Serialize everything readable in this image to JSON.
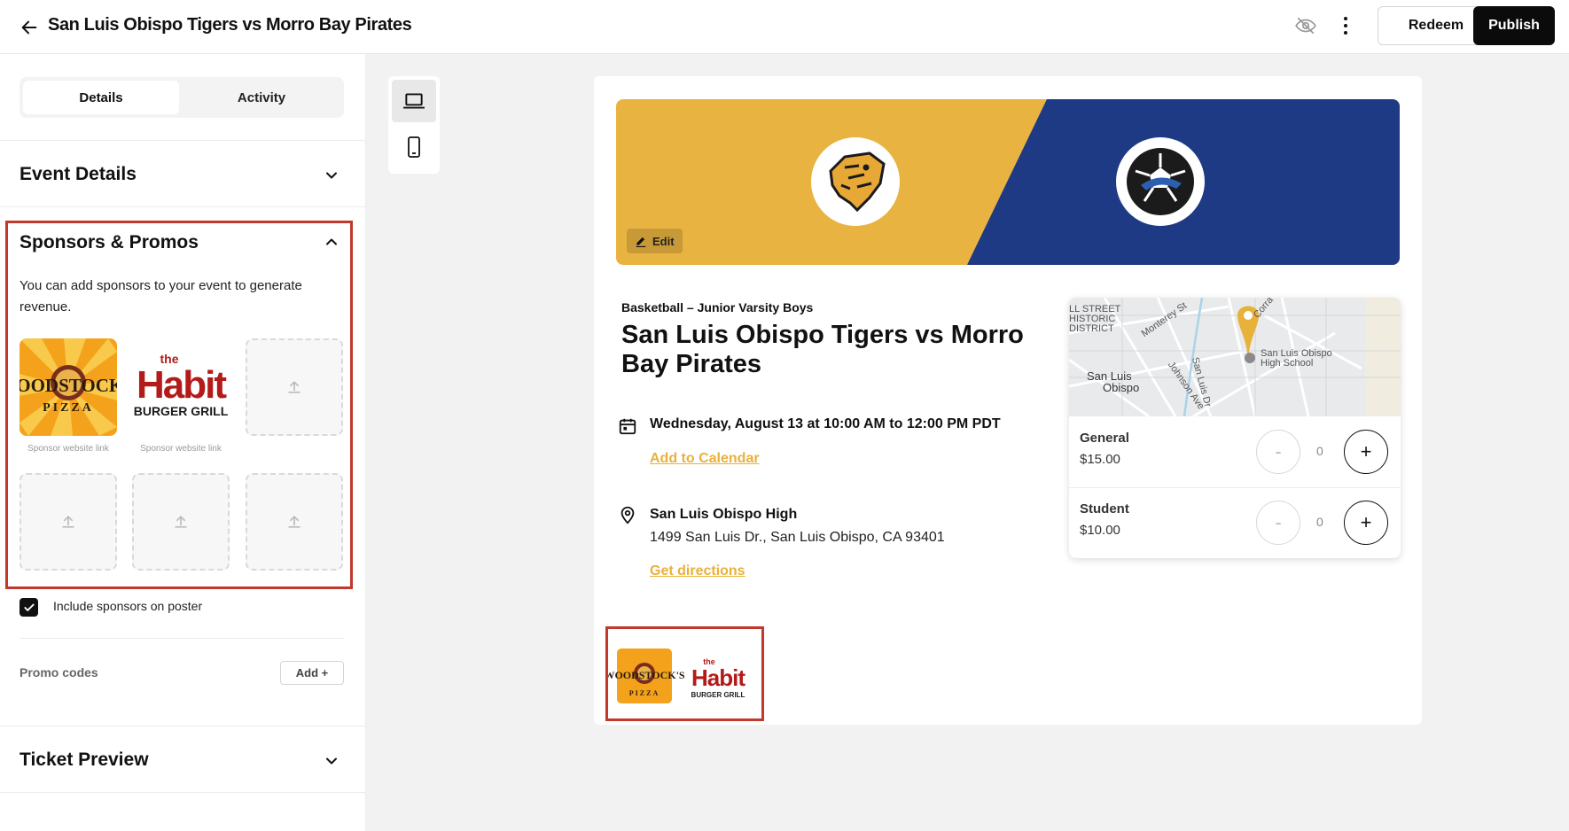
{
  "header": {
    "title": "San Luis Obispo Tigers vs Morro Bay Pirates",
    "redeem_label": "Redeem",
    "publish_label": "Publish",
    "icons": {
      "back": "arrow-left-icon",
      "visibility": "eye-off-icon",
      "more": "kebab-icon"
    }
  },
  "sidebar": {
    "tabs": [
      {
        "label": "Details",
        "active": true
      },
      {
        "label": "Activity",
        "active": false
      }
    ],
    "event_details_title": "Event Details",
    "sponsors_title": "Sponsors & Promos",
    "sponsors_desc": "You can add sponsors to your event to generate revenue.",
    "sponsor_caption": "Sponsor website link",
    "sponsors": [
      {
        "name": "WOODSTOCK'S",
        "sub": "PIZZA"
      },
      {
        "name": "the",
        "name2": "Habit",
        "sub": "BURGER GRILL"
      }
    ],
    "include_sponsors_label": "Include sponsors on poster",
    "include_sponsors_checked": true,
    "promo_codes_label": "Promo codes",
    "add_label": "Add",
    "ticket_preview_title": "Ticket Preview"
  },
  "preview": {
    "edit_label": "Edit",
    "sport": "Basketball – Junior Varsity Boys",
    "title": "San Luis Obispo Tigers vs Morro Bay Pirates",
    "datetime": "Wednesday, August 13 at 10:00 AM to 12:00 PM PDT",
    "add_calendar": "Add to Calendar",
    "venue": "San Luis Obispo High",
    "address": "1499 San Luis Dr., San Luis Obispo, CA 93401",
    "directions": "Get directions",
    "banner_colors": {
      "left": "#e8b341",
      "right": "#1f3a85"
    },
    "accent_color": "#e8b13a",
    "map": {
      "district": [
        "LL STREET",
        "HISTORIC",
        "DISTRICT"
      ],
      "city": [
        "San Luis",
        "Obispo"
      ],
      "school": [
        "San Luis Obispo",
        "High School"
      ],
      "streets": [
        "Monterey St",
        "Johnson Ave",
        "San Luis Dr",
        "Corra"
      ]
    },
    "tickets": [
      {
        "name": "General",
        "price": "$15.00",
        "qty": "0",
        "minus": "-",
        "plus": "+"
      },
      {
        "name": "Student",
        "price": "$10.00",
        "qty": "0",
        "minus": "-",
        "plus": "+"
      }
    ]
  }
}
